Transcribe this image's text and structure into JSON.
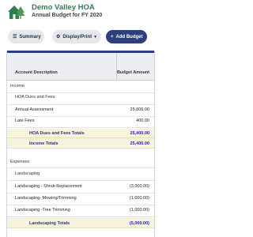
{
  "header": {
    "org_name": "Demo Valley HOA",
    "subtitle": "Annual Budget for FY 2020",
    "logo_icon": "house-tree-logo",
    "brand_color": "#2e7d4f"
  },
  "toolbar": {
    "summary_label": "Summary",
    "summary_icon": "menu-lines-icon",
    "display_label": "Display/Print",
    "display_icon": "gear-icon",
    "display_caret": "chevron-down-icon",
    "add_label": "Add Budget",
    "add_icon": "plus-icon",
    "accent": "#2d3f7c"
  },
  "table": {
    "col_desc": "Account Description",
    "col_amount": "Budget Amount",
    "income_header": "Income",
    "hoa_group": "HOA Dues and Fees",
    "rows_hoa": [
      {
        "desc": "Annual Assessment",
        "amount": "25,000.00"
      },
      {
        "desc": "Late Fees",
        "amount": "400.00"
      }
    ],
    "hoa_total_label": "HOA Dues and Fees Totals",
    "hoa_total_amount": "25,400.00",
    "income_total_label": "Income Totals",
    "income_total_amount": "25,400.00",
    "expenses_header": "Expenses",
    "landscaping_group": "Landscaping",
    "rows_landscaping": [
      {
        "desc": "Landscaping - Shrub Replacement",
        "amount": "(3,000.00)"
      },
      {
        "desc": "Landscaping- Mowing/Trimming",
        "amount": "(1,000.00)"
      },
      {
        "desc": "Landscaping -Tree Trimming",
        "amount": "(1,000.00)"
      }
    ],
    "landscaping_total_label": "Landscaping Totals",
    "landscaping_total_amount": "(5,000.00)",
    "total_row_color": "#f7f3dd",
    "total_amount_color": "#2222cc"
  }
}
